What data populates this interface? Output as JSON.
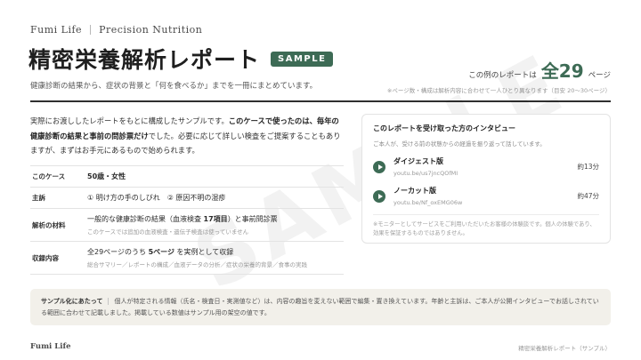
{
  "header": {
    "brand": "Fumi Life",
    "tagline": "Precision Nutrition",
    "title": "精密栄養解析レポート",
    "badge": "SAMPLE",
    "subtitle": "健康診断の結果から、症状の背景と「何を食べるか」までを一冊にまとめています。",
    "pages_prefix": "この例のレポートは",
    "pages_count": "全29",
    "pages_suffix": "ページ",
    "pages_note": "※ページ数・構成は解析内容に合わせて一人ひとり異なります（目安 20〜30ページ）"
  },
  "watermark": "SAMPLE",
  "intro": {
    "part1": "実際にお渡ししたレポートをもとに構成したサンプルです。",
    "part2_bold": "このケースで使ったのは、毎年の健康診断の結果と事前の問診票だけ",
    "part3": "でした。必要に応じて詳しい検査をご提案することもありますが、まずはお手元にあるもので始められます。"
  },
  "info": {
    "case_label": "このケース",
    "case_value": "50歳・女性",
    "complaint_label": "主訴",
    "complaint_value": "① 明け方の手のしびれ　② 原因不明の湿疹",
    "materials_label": "解析の材料",
    "materials_value_a": "一般的な健康診断の結果（血液検査 ",
    "materials_value_bold": "17項目",
    "materials_value_b": "）と事前問診票",
    "materials_sub": "このケースでは追加の血液検査・遺伝子検査は使っていません",
    "contents_label": "収録内容",
    "contents_value_a": "全29ページのうち ",
    "contents_value_bold": "5ページ",
    "contents_value_b": " を実例として収録",
    "contents_sub": "総合サマリー／レポートの構成／血液データの分析／症状の栄養的背景／食事の実践"
  },
  "card": {
    "title": "このレポートを受け取った方のインタビュー",
    "desc": "ご本人が、受ける前の状態からの経過を振り返って話しています。",
    "videos": [
      {
        "name": "ダイジェスト版",
        "url": "youtu.be/us7jncQOfMI",
        "duration": "約13分"
      },
      {
        "name": "ノーカット版",
        "url": "youtu.be/Nf_oxEMG06w",
        "duration": "約47分"
      }
    ],
    "note": "※モニターとしてサービスをご利用いただいたお客様の体験談です。個人の体験であり、効果を保証するものではありません。"
  },
  "footnote": {
    "label": "サンプル化にあたって",
    "text": "個人が特定される情報（氏名・検査日・実測値など）は、内容の趣旨を変えない範囲で編集・置き換えています。年齢と主訴は、ご本人が公開インタビューでお話しされている範囲に合わせて記載しました。掲載している数値はサンプル用の架空の値です。"
  },
  "footer": {
    "brand": "Fumi Life",
    "right": "精密栄養解析レポート（サンプル）"
  }
}
